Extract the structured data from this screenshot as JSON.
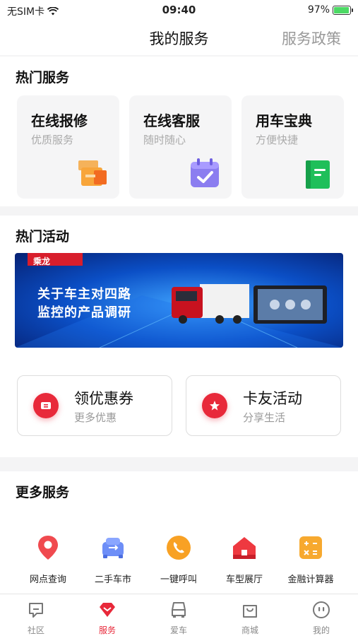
{
  "status_bar": {
    "carrier": "无SIM卡",
    "time": "09:40",
    "battery": "97%",
    "battery_level": 0.97
  },
  "nav": {
    "title": "我的服务",
    "right_link": "服务政策"
  },
  "hot_services": {
    "title": "热门服务",
    "items": [
      {
        "title": "在线报修",
        "subtitle": "优质服务",
        "icon": "toolbox-icon"
      },
      {
        "title": "在线客服",
        "subtitle": "随时随心",
        "icon": "calendar-check-icon"
      },
      {
        "title": "用车宝典",
        "subtitle": "方便快捷",
        "icon": "green-book-icon"
      }
    ]
  },
  "hot_activities": {
    "title": "热门活动",
    "banner": {
      "brand": "乘龙",
      "line1": "关于车主对四路",
      "line2": "监控的产品调研"
    },
    "cards": [
      {
        "title": "领优惠券",
        "subtitle": "更多优惠",
        "icon": "coupon-icon"
      },
      {
        "title": "卡友活动",
        "subtitle": "分享生活",
        "icon": "star-icon"
      }
    ]
  },
  "more_services": {
    "title": "更多服务",
    "items": [
      {
        "label": "网点查询",
        "icon": "location-pin-icon"
      },
      {
        "label": "二手车市",
        "icon": "used-car-icon"
      },
      {
        "label": "一键呼叫",
        "icon": "phone-icon"
      },
      {
        "label": "车型展厅",
        "icon": "showroom-icon"
      },
      {
        "label": "金融计算器",
        "icon": "calculator-icon"
      }
    ]
  },
  "tab_bar": {
    "active": "服务",
    "tabs": [
      {
        "label": "社区",
        "icon": "chat-icon"
      },
      {
        "label": "服务",
        "icon": "heart-diamond-icon"
      },
      {
        "label": "爱车",
        "icon": "truck-icon"
      },
      {
        "label": "商城",
        "icon": "shopping-bag-icon"
      },
      {
        "label": "我的",
        "icon": "face-icon"
      }
    ]
  },
  "colors": {
    "accent": "#e8293a",
    "muted": "#999999",
    "card_bg": "#f5f5f6"
  }
}
